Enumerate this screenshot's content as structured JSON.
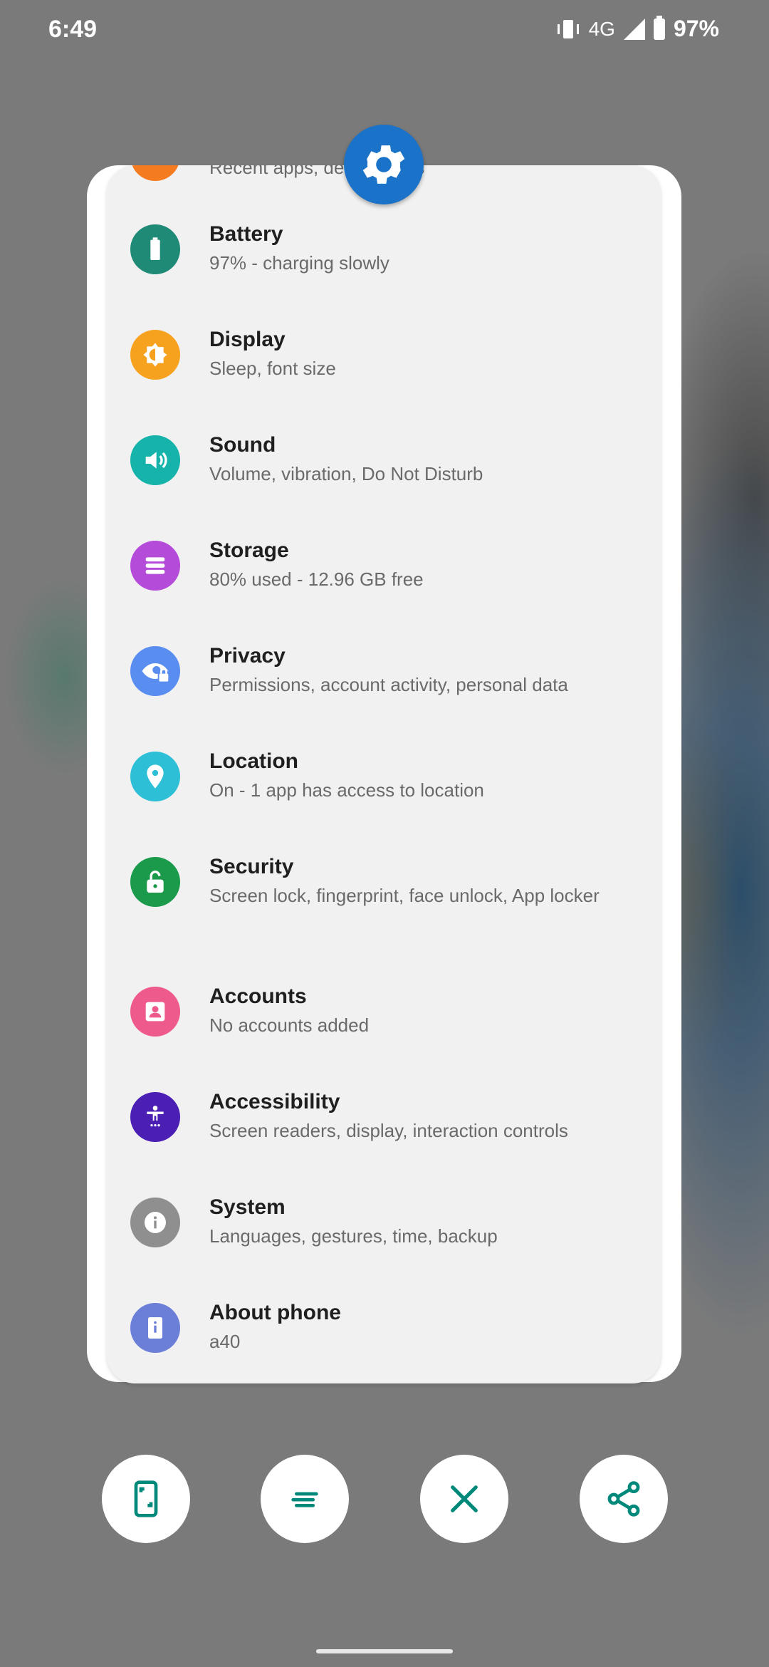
{
  "status_bar": {
    "time": "6:49",
    "network": "4G",
    "battery": "97%",
    "icons": [
      "vibrate-icon",
      "signal-icon",
      "battery-charging-icon"
    ]
  },
  "settings": {
    "partial_item_subtitle": "Recent apps, default apps",
    "items": [
      {
        "title": "Battery",
        "subtitle": "97% - charging slowly",
        "icon": "battery-icon",
        "color": "#1f8a76"
      },
      {
        "title": "Display",
        "subtitle": "Sleep, font size",
        "icon": "brightness-icon",
        "color": "#f6a21e"
      },
      {
        "title": "Sound",
        "subtitle": "Volume, vibration, Do Not Disturb",
        "icon": "volume-icon",
        "color": "#16b3aa"
      },
      {
        "title": "Storage",
        "subtitle": "80% used - 12.96 GB free",
        "icon": "storage-icon",
        "color": "#b44cd9"
      },
      {
        "title": "Privacy",
        "subtitle": "Permissions, account activity, personal data",
        "icon": "privacy-eye-icon",
        "color": "#5a8df0"
      },
      {
        "title": "Location",
        "subtitle": "On - 1 app has access to location",
        "icon": "location-pin-icon",
        "color": "#2cbfd6"
      },
      {
        "title": "Security",
        "subtitle": "Screen lock, fingerprint, face unlock, App locker",
        "icon": "unlock-icon",
        "color": "#1a9a4a"
      },
      {
        "title": "Accounts",
        "subtitle": "No accounts added",
        "icon": "account-icon",
        "color": "#ee5a8c"
      },
      {
        "title": "Accessibility",
        "subtitle": "Screen readers, display, interaction controls",
        "icon": "accessibility-icon",
        "color": "#4b1fb4"
      },
      {
        "title": "System",
        "subtitle": "Languages, gestures, time, backup",
        "icon": "info-icon",
        "color": "#8f8f8f"
      },
      {
        "title": "About phone",
        "subtitle": "a40",
        "icon": "phone-info-icon",
        "color": "#6c7fd8"
      }
    ]
  },
  "actions": [
    {
      "name": "screenshot-button",
      "icon": "screenshot-phone-icon"
    },
    {
      "name": "select-text-button",
      "icon": "text-lines-icon"
    },
    {
      "name": "close-button",
      "icon": "close-icon"
    },
    {
      "name": "share-button",
      "icon": "share-icon"
    }
  ],
  "colors": {
    "accent": "#00897b",
    "settings_badge": "#1a73c8"
  }
}
